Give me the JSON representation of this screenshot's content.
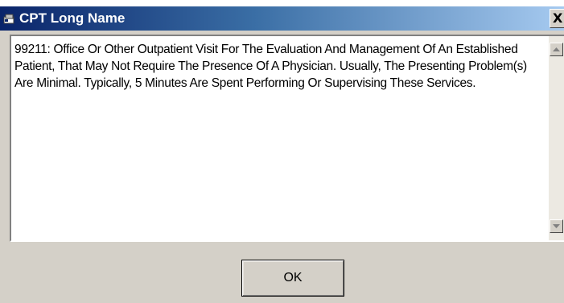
{
  "window": {
    "title": "CPT Long Name",
    "close_label": "X",
    "title_icon": "window-app-icon",
    "colors": {
      "titlebar_start": "#0a246a",
      "titlebar_end": "#a6caf0",
      "face": "#d4d0c8"
    }
  },
  "description": {
    "text": "99211: Office Or Other Outpatient Visit For The Evaluation And Management Of An Established Patient, That May Not Require The Presence Of A Physician. Usually, The Presenting Problem(s) Are Minimal. Typically, 5 Minutes Are Spent Performing Or Supervising These Services."
  },
  "scrollbar": {
    "up_icon": "scroll-up-arrow-icon",
    "down_icon": "scroll-down-arrow-icon"
  },
  "buttons": {
    "ok_label": "OK"
  }
}
